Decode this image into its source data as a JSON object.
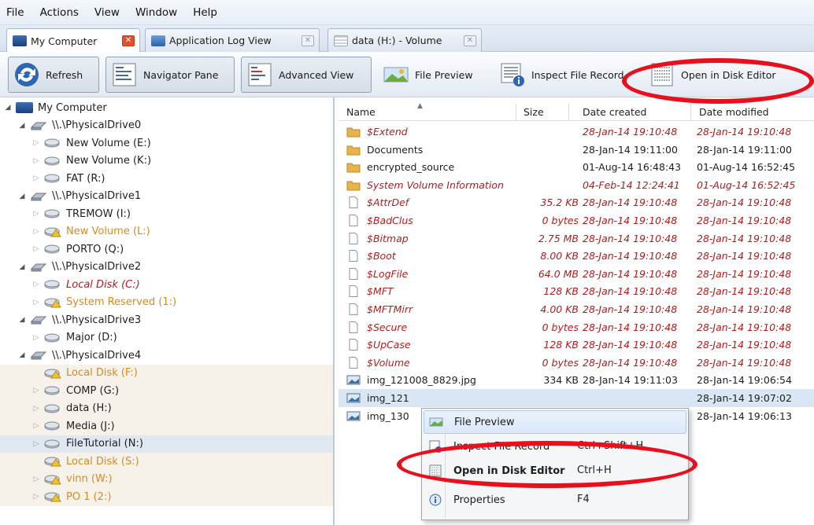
{
  "menu": [
    "File",
    "Actions",
    "View",
    "Window",
    "Help"
  ],
  "tabs": [
    {
      "label": "My Computer"
    },
    {
      "label": "Application Log View"
    },
    {
      "label": "data (H:) - Volume"
    }
  ],
  "toolbar": {
    "refresh": "Refresh",
    "navigator_pane": "Navigator Pane",
    "advanced_view": "Advanced View",
    "file_preview": "File Preview",
    "inspect_file_record": "Inspect File Record",
    "open_disk_editor": "Open in Disk Editor"
  },
  "tree": [
    {
      "label": "My Computer",
      "indent": 0,
      "state": "open",
      "icon": "computer-icon"
    },
    {
      "label": "\\\\.\\PhysicalDrive0",
      "indent": 1,
      "state": "open",
      "icon": "harddisk-icon"
    },
    {
      "label": "New Volume (E:)",
      "indent": 2,
      "state": "closed",
      "icon": "volume-icon"
    },
    {
      "label": "New Volume (K:)",
      "indent": 2,
      "state": "closed",
      "icon": "volume-icon"
    },
    {
      "label": "FAT (R:)",
      "indent": 2,
      "state": "closed",
      "icon": "volume-icon"
    },
    {
      "label": "\\\\.\\PhysicalDrive1",
      "indent": 1,
      "state": "open",
      "icon": "harddisk-icon"
    },
    {
      "label": "TREMOW (I:)",
      "indent": 2,
      "state": "closed",
      "icon": "volume-icon"
    },
    {
      "label": "New Volume (L:)",
      "indent": 2,
      "state": "closed",
      "icon": "volume-warning-icon",
      "style": "orange"
    },
    {
      "label": "PORTO (Q:)",
      "indent": 2,
      "state": "closed",
      "icon": "volume-icon"
    },
    {
      "label": "\\\\.\\PhysicalDrive2",
      "indent": 1,
      "state": "open",
      "icon": "harddisk-icon"
    },
    {
      "label": "Local Disk (C:)",
      "indent": 2,
      "state": "closed",
      "icon": "volume-icon",
      "style": "redit"
    },
    {
      "label": "System Reserved (1:)",
      "indent": 2,
      "state": "closed",
      "icon": "volume-warning-icon",
      "style": "orange"
    },
    {
      "label": "\\\\.\\PhysicalDrive3",
      "indent": 1,
      "state": "open",
      "icon": "harddisk-icon"
    },
    {
      "label": "Major (D:)",
      "indent": 2,
      "state": "closed",
      "icon": "volume-icon"
    },
    {
      "label": "\\\\.\\PhysicalDrive4",
      "indent": 1,
      "state": "open",
      "icon": "harddisk-icon"
    },
    {
      "label": "Local Disk (F:)",
      "indent": 2,
      "state": "none",
      "icon": "volume-warning-icon",
      "style": "orange"
    },
    {
      "label": "COMP (G:)",
      "indent": 2,
      "state": "closed",
      "icon": "volume-icon"
    },
    {
      "label": "data (H:)",
      "indent": 2,
      "state": "closed",
      "icon": "volume-icon"
    },
    {
      "label": "Media (J:)",
      "indent": 2,
      "state": "closed",
      "icon": "volume-icon"
    },
    {
      "label": "FileTutorial (N:)",
      "indent": 2,
      "state": "closed",
      "icon": "volume-icon",
      "selected": true
    },
    {
      "label": "Local Disk (S:)",
      "indent": 2,
      "state": "none",
      "icon": "volume-warning-icon",
      "style": "orange"
    },
    {
      "label": "vinn (W:)",
      "indent": 2,
      "state": "closed",
      "icon": "volume-warning-icon",
      "style": "orange"
    },
    {
      "label": "PO 1 (2:)",
      "indent": 2,
      "state": "closed",
      "icon": "volume-warning-icon",
      "style": "orange"
    }
  ],
  "file_columns": [
    "Name",
    "Size",
    "Date created",
    "Date modified"
  ],
  "files": [
    {
      "name": "$Extend",
      "size": "",
      "created": "28-Jan-14 19:10:48",
      "modified": "28-Jan-14 19:10:48",
      "type": "folder",
      "system": true
    },
    {
      "name": "Documents",
      "size": "",
      "created": "28-Jan-14 19:11:00",
      "modified": "28-Jan-14 19:11:00",
      "type": "folder",
      "system": false
    },
    {
      "name": "encrypted_source",
      "size": "",
      "created": "01-Aug-14 16:48:43",
      "modified": "01-Aug-14 16:52:45",
      "type": "folder",
      "system": false
    },
    {
      "name": "System Volume Information",
      "size": "",
      "created": "04-Feb-14 12:24:41",
      "modified": "01-Aug-14 16:52:45",
      "type": "folder",
      "system": true
    },
    {
      "name": "$AttrDef",
      "size": "35.2 KB",
      "created": "28-Jan-14 19:10:48",
      "modified": "28-Jan-14 19:10:48",
      "type": "file",
      "system": true
    },
    {
      "name": "$BadClus",
      "size": "0 bytes",
      "created": "28-Jan-14 19:10:48",
      "modified": "28-Jan-14 19:10:48",
      "type": "file",
      "system": true
    },
    {
      "name": "$Bitmap",
      "size": "2.75 MB",
      "created": "28-Jan-14 19:10:48",
      "modified": "28-Jan-14 19:10:48",
      "type": "file",
      "system": true
    },
    {
      "name": "$Boot",
      "size": "8.00 KB",
      "created": "28-Jan-14 19:10:48",
      "modified": "28-Jan-14 19:10:48",
      "type": "file",
      "system": true
    },
    {
      "name": "$LogFile",
      "size": "64.0 MB",
      "created": "28-Jan-14 19:10:48",
      "modified": "28-Jan-14 19:10:48",
      "type": "file",
      "system": true
    },
    {
      "name": "$MFT",
      "size": "128 KB",
      "created": "28-Jan-14 19:10:48",
      "modified": "28-Jan-14 19:10:48",
      "type": "file",
      "system": true
    },
    {
      "name": "$MFTMirr",
      "size": "4.00 KB",
      "created": "28-Jan-14 19:10:48",
      "modified": "28-Jan-14 19:10:48",
      "type": "file",
      "system": true
    },
    {
      "name": "$Secure",
      "size": "0 bytes",
      "created": "28-Jan-14 19:10:48",
      "modified": "28-Jan-14 19:10:48",
      "type": "file",
      "system": true
    },
    {
      "name": "$UpCase",
      "size": "128 KB",
      "created": "28-Jan-14 19:10:48",
      "modified": "28-Jan-14 19:10:48",
      "type": "file",
      "system": true
    },
    {
      "name": "$Volume",
      "size": "0 bytes",
      "created": "28-Jan-14 19:10:48",
      "modified": "28-Jan-14 19:10:48",
      "type": "file",
      "system": true
    },
    {
      "name": "img_121008_8829.jpg",
      "size": "334 KB",
      "created": "28-Jan-14 19:11:03",
      "modified": "28-Jan-14 19:06:54",
      "type": "image",
      "system": false
    },
    {
      "name": "img_121",
      "size": "",
      "created": "",
      "modified": "28-Jan-14 19:07:02",
      "type": "image",
      "system": false,
      "selected": true
    },
    {
      "name": "img_130",
      "size": "",
      "created": "",
      "modified": "28-Jan-14 19:06:13",
      "type": "image",
      "system": false
    }
  ],
  "context_menu": [
    {
      "label": "File Preview",
      "shortcut": "",
      "icon": "file-preview-icon",
      "hover": true
    },
    {
      "label": "Inspect File Record",
      "shortcut": "Ctrl+Shift+H",
      "icon": "inspect-record-icon"
    },
    {
      "label": "Open in Disk Editor",
      "shortcut": "Ctrl+H",
      "icon": "disk-editor-icon",
      "bold": true
    },
    {
      "label": "Properties",
      "shortcut": "F4",
      "icon": "info-icon"
    }
  ],
  "colors": {
    "system_file": "#b41c1c",
    "warning_volume": "#d98a1e",
    "highlight_ellipse": "#e8101c"
  }
}
